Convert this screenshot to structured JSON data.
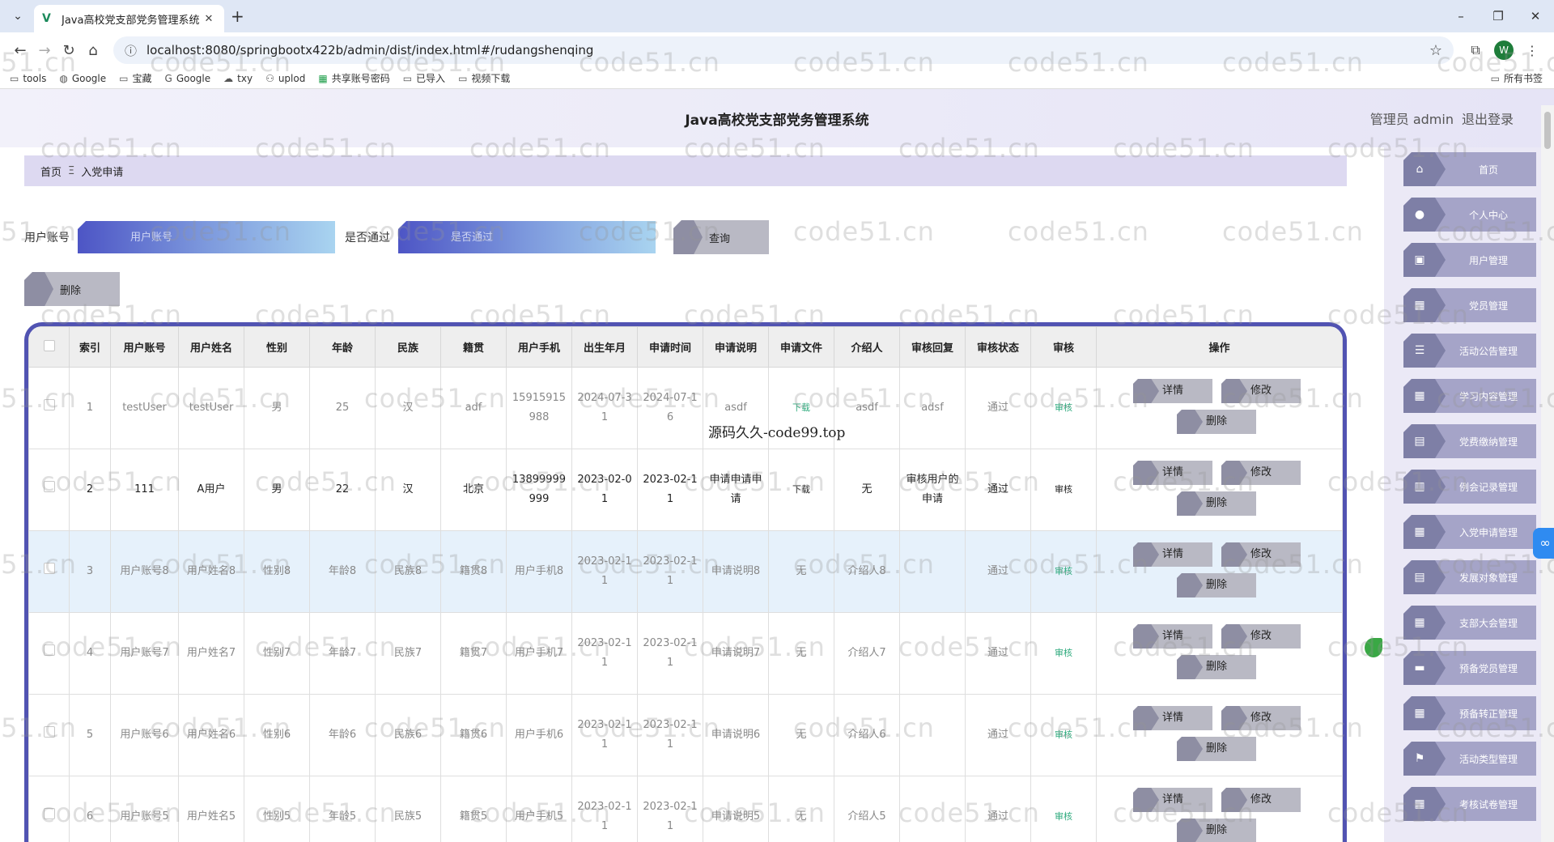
{
  "browser": {
    "tab_title": "Java高校党支部党务管理系统",
    "url": "localhost:8080/springbootx422b/admin/dist/index.html#/rudangshenqing",
    "profile_initial": "W",
    "bookmarks": [
      "tools",
      "Google",
      "宝藏",
      "Google",
      "txy",
      "uplod",
      "共享账号密码",
      "已导入",
      "视频下载"
    ],
    "bookmarks_right": "所有书签"
  },
  "app": {
    "title": "Java高校党支部党务管理系统",
    "user_label": "管理员 admin",
    "logout_label": "退出登录"
  },
  "breadcrumb": {
    "home": "首页",
    "separator": "Ξ",
    "current": "入党申请"
  },
  "search": {
    "account_label": "用户账号",
    "account_placeholder": "用户账号",
    "pass_label": "是否通过",
    "pass_placeholder": "是否通过",
    "query_button": "查询",
    "delete_button": "删除"
  },
  "table": {
    "headers": [
      "",
      "索引",
      "用户账号",
      "用户姓名",
      "性别",
      "年龄",
      "民族",
      "籍贯",
      "用户手机",
      "出生年月",
      "申请时间",
      "申请说明",
      "申请文件",
      "介绍人",
      "审核回复",
      "审核状态",
      "审核",
      "操作"
    ],
    "actions": {
      "detail": "详情",
      "edit": "修改",
      "delete": "删除"
    },
    "rows": [
      {
        "index": "1",
        "account": "testUser",
        "name": "testUser",
        "gender": "男",
        "age": "25",
        "ethnic": "汉",
        "native": "adf",
        "phone": "15915915988",
        "birth": "2024-07-31",
        "apply_time": "2024-07-16",
        "desc": "asdf",
        "file": "下载",
        "introducer": "asdf",
        "reply": "adsf",
        "status": "通过",
        "review": "审核"
      },
      {
        "index": "2",
        "account": "111",
        "name": "A用户",
        "gender": "男",
        "age": "22",
        "ethnic": "汉",
        "native": "北京",
        "phone": "13899999999",
        "birth": "2023-02-01",
        "apply_time": "2023-02-11",
        "desc": "申请申请申请",
        "file": "下载",
        "introducer": "无",
        "reply": "审核用户的申请",
        "status": "通过",
        "review": "审核"
      },
      {
        "index": "3",
        "account": "用户账号8",
        "name": "用户姓名8",
        "gender": "性别8",
        "age": "年龄8",
        "ethnic": "民族8",
        "native": "籍贯8",
        "phone": "用户手机8",
        "birth": "2023-02-11",
        "apply_time": "2023-02-11",
        "desc": "申请说明8",
        "file": "无",
        "introducer": "介绍人8",
        "reply": "",
        "status": "通过",
        "review": "审核"
      },
      {
        "index": "4",
        "account": "用户账号7",
        "name": "用户姓名7",
        "gender": "性别7",
        "age": "年龄7",
        "ethnic": "民族7",
        "native": "籍贯7",
        "phone": "用户手机7",
        "birth": "2023-02-11",
        "apply_time": "2023-02-11",
        "desc": "申请说明7",
        "file": "无",
        "introducer": "介绍人7",
        "reply": "",
        "status": "通过",
        "review": "审核"
      },
      {
        "index": "5",
        "account": "用户账号6",
        "name": "用户姓名6",
        "gender": "性别6",
        "age": "年龄6",
        "ethnic": "民族6",
        "native": "籍贯6",
        "phone": "用户手机6",
        "birth": "2023-02-11",
        "apply_time": "2023-02-11",
        "desc": "申请说明6",
        "file": "无",
        "introducer": "介绍人6",
        "reply": "",
        "status": "通过",
        "review": "审核"
      },
      {
        "index": "6",
        "account": "用户账号5",
        "name": "用户姓名5",
        "gender": "性别5",
        "age": "年龄5",
        "ethnic": "民族5",
        "native": "籍贯5",
        "phone": "用户手机5",
        "birth": "2023-02-11",
        "apply_time": "2023-02-11",
        "desc": "申请说明5",
        "file": "无",
        "introducer": "介绍人5",
        "reply": "",
        "status": "通过",
        "review": "审核"
      }
    ]
  },
  "overlay_text": "源码久久-code99.top",
  "sidebar": {
    "items": [
      {
        "label": "首页",
        "icon": "home-icon"
      },
      {
        "label": "个人中心",
        "icon": "user-icon"
      },
      {
        "label": "用户管理",
        "icon": "lock-icon"
      },
      {
        "label": "党员管理",
        "icon": "grid-icon"
      },
      {
        "label": "活动公告管理",
        "icon": "list-icon"
      },
      {
        "label": "学习内容管理",
        "icon": "grid-icon"
      },
      {
        "label": "党费缴纳管理",
        "icon": "file-icon"
      },
      {
        "label": "例会记录管理",
        "icon": "book-icon"
      },
      {
        "label": "入党申请管理",
        "icon": "grid-icon"
      },
      {
        "label": "发展对象管理",
        "icon": "doc-icon"
      },
      {
        "label": "支部大会管理",
        "icon": "grid-icon"
      },
      {
        "label": "预备党员管理",
        "icon": "ticket-icon"
      },
      {
        "label": "预备转正管理",
        "icon": "grid-icon"
      },
      {
        "label": "活动类型管理",
        "icon": "flag-icon"
      },
      {
        "label": "考核试卷管理",
        "icon": "grid-icon"
      }
    ]
  },
  "watermark": "code51.cn"
}
